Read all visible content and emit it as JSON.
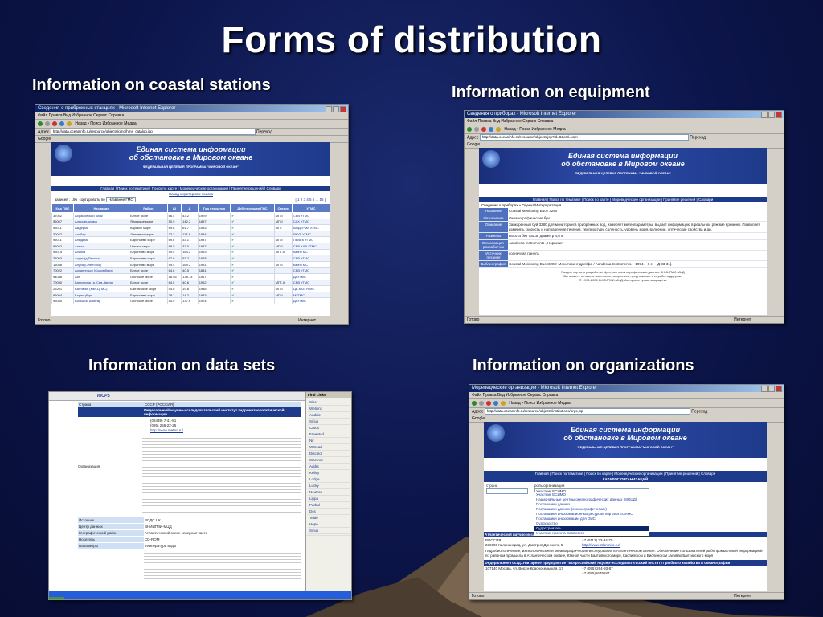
{
  "slide": {
    "title": "Forms of distribution",
    "captions": {
      "coastal": "Information on coastal stations",
      "equipment": "Information on equipment",
      "datasets": "Information on data sets",
      "organizations": "Information on organizations"
    }
  },
  "browser": {
    "status_done": "Готово",
    "status_zone": "Интернет",
    "menu": "Файл  Правка  Вид  Избранное  Сервис  Справка",
    "toolbar": "Назад  •  Поиск  Избранное  Медиа",
    "address_label": "Адрес",
    "go_label": "Переход",
    "google_label": "Google",
    "banner_line1": "Единая система информации",
    "banner_line2": "об обстановке в Мировом океане",
    "banner_sub": "ФЕДЕРАЛЬНАЯ ЦЕЛЕВАЯ ПРОГРАММА \"МИРОВОЙ ОКЕАН\"",
    "nav": "Главная | Поиск по тематике | Поиск по карте | Мореведческие организации | Принятие решений | Словари"
  },
  "coastal": {
    "title": "Сведения о прибрежных станциях - Microsoft Internet Explorer",
    "address": "http://data.oceaninfo.ru/resource/objects/gmo/hms_catalog.jsp",
    "back_link": "Назад к критериям поиска",
    "records": "записей : 196",
    "sort_label": "сортировать по",
    "sort_value": "Название ГМС",
    "pages": "[ 1 2 3 4 5 6 ... 15 ]",
    "columns": [
      "Код ГМС",
      "Название",
      "Район",
      "Ш",
      "Д",
      "Год открытия",
      "Действующая ГМС",
      "Статус",
      "УГМС"
    ],
    "rows": [
      [
        "37062",
        "Абрамовский маяк",
        "Белое море",
        "66.4",
        "43.2",
        "1929",
        "✔",
        "МГ-II",
        "СЕВ УГМС"
      ],
      [
        "96007",
        "Александровск",
        "Японское море",
        "50.9",
        "142.2",
        "1897",
        "✔",
        "МГ-II",
        "САХ УГМС"
      ],
      [
        "95011",
        "Амдерма",
        "Карское море",
        "69.8",
        "61.7",
        "1933",
        "✔",
        "МГ-I",
        "АМДЕРМА УГМС"
      ],
      [
        "30027",
        "Анабар",
        "Лаптевых море",
        "73.2",
        "113.8",
        "1934",
        "✔",
        "",
        "ЯКУТ УГМС"
      ],
      [
        "95011",
        "Аныдьма",
        "Баренцево море",
        "69.6",
        "33.1",
        "1937",
        "✔",
        "МГ-II",
        "ПЕВЕК УГМС"
      ],
      [
        "95062",
        "Анюка",
        "Чукотск море",
        "68.5",
        "37.0",
        "1937",
        "✔",
        "МГ-II",
        "СЕВ-КАВ УГМС"
      ],
      [
        "95015",
        "Анапка",
        "Берингово море",
        "59.5",
        "164.2",
        "1963",
        "✔",
        "МГТ-II",
        "КамУГМС"
      ],
      [
        "37003",
        "Андег (д.Печора)",
        "Баренцево море",
        "67.9",
        "53.2",
        "1978",
        "✔",
        "",
        "СЕВ УГМС"
      ],
      [
        "15036",
        "Апуха (Олюторка)",
        "Берингово море",
        "59.4",
        "169.2",
        "1951",
        "✔",
        "МГ-II",
        "КамУГМС"
      ],
      [
        "70022",
        "Архангельск (Соломбала)",
        "Белое море",
        "64.6",
        "40.5",
        "1881",
        "✔",
        "",
        "СЕВ УГМС"
      ],
      [
        "94046",
        "Аян",
        "Охотское море",
        "56.46",
        "138.13",
        "1917",
        "✔",
        "",
        "ДВУГМС"
      ],
      [
        "70030",
        "Баталрица (д. Сев.Двина)",
        "Белое море",
        "64.5",
        "40.6",
        "1962",
        "✔",
        "МГТ-II",
        "СЕВ УГМС"
      ],
      [
        "26201",
        "Балтийск (Кал-ЦГМС)",
        "Балтийское море",
        "54.6",
        "19.8",
        "1946",
        "✔",
        "МГ-II",
        "ЦБ-КАЛ УГМС"
      ],
      [
        "95004",
        "Баренцбург",
        "Баренцево море",
        "78.1",
        "14.2",
        "1933",
        "✔",
        "МГ-II",
        "МУГМС"
      ],
      [
        "96030",
        "Большой Шантар",
        "Охотское море",
        "54.9",
        "137.6",
        "1924",
        "✔",
        "",
        "ДВУГМС"
      ]
    ]
  },
  "equipment": {
    "title": "Сведения о приборах - Microsoft Internet Explorer",
    "address": "http://data.oceaninfo.ru/resource/objects.jsp?id=8&ord=kam",
    "breadcrumb": "Сведения о приборах » Оценка/Интерпретация",
    "fields": [
      {
        "label": "Название",
        "value": "Coastal Monitoring Buoy 3280"
      },
      {
        "label": "Назначение",
        "value": "Океанографические буи"
      },
      {
        "label": "Описание",
        "value": "Заякоренный буй 3280 для мониторинга прибрежных вод, измеряет метеопараметры, выдает информацию в реальном режиме времени. Позволяет измерять скорость и направление течения, температуру, соленость, уровень моря, волнение, оптические свойства и др."
      },
      {
        "label": "Размеры",
        "value": "высота без троса, диаметр 4,6 м"
      },
      {
        "label": "Организация-разработчик",
        "value": "Aanderaa Instruments , Норвегия"
      },
      {
        "label": "Источник питания",
        "value": "солнечная панель"
      },
      {
        "label": "Библиография",
        "value": "Coastal Monitoring Buoy3280: Мониторинг дрейфа / Aanderaa Instruments. - 1994. - 8 с. - [Д 33-31]."
      }
    ],
    "footer1": "Раздел портала разработан Центром океанографических данных ВНИИГМИ-МЦД",
    "footer2": "Вы можете оставить замечание, вопрос или предложение в службе поддержки",
    "footer3": "© 1999-2005 ВНИИГМИ-МЦД. Авторские права защищены"
  },
  "datasets": {
    "country_label": "Страна",
    "country_value": "СССР (РОССИЯ)",
    "org_label": "Организация",
    "org_value": "Федеральный научно-исследовательский институт гидрометеорологической информации",
    "phone": "(08439) 7-41-81",
    "fax": "(095) 255-22-25",
    "web": "http://www.meteo.ru/",
    "source_label": "Источник",
    "source_value": "ВОДС ЦК",
    "center_label": "Центр данных",
    "center_value": "ВНИИГМИ-МЦД",
    "region_label": "Географический район",
    "region_value": "Атлантический океан северная часть",
    "carrier_label": "Носитель",
    "carrier_value": "CD-ROM",
    "params_label": "Параметры",
    "params_value": "Температура воды",
    "sidebar": [
      "Sibel",
      "Weblink",
      "Andale",
      "Sirius",
      "Cards",
      "FreeMad",
      "Nif",
      "W3read",
      "Discolor",
      "Warsnet",
      "Addrs",
      "Kelley",
      "Lodge",
      "Lucky",
      "Neutron",
      "Lippa",
      "Parbul",
      "Dcs",
      "Telde",
      "Hope",
      "Sirius"
    ],
    "sidebar_title": "Find Links"
  },
  "organizations": {
    "title": "Мореведческие организации - Microsoft Internet Explorer",
    "address": "http://data.oceaninfo.ru/resource/objects/institutions/orgs.jsp",
    "section": "КАТАЛОГ ОРГАНИЗАЦИЙ",
    "filter_country": "страна",
    "filter_role": "роль организации",
    "filter_value": "Участник ЕСИМО",
    "dropdown": [
      "Участник ЕСИМО",
      "Национальные центры океанографических данных (МОЦД)",
      "Поставщики данных",
      "Поставщики данных (океанографических)",
      "Поставщики информационных ресурсов портала ЕСИМО",
      "Поставщики информации для ОИС",
      "Судоходство",
      "Судостроитель",
      "Участник проекта SeaSearch"
    ],
    "org1": "Атлантический научно-исследовательский институт рыбного хозяйства и океанографии",
    "org1_addr": "236000 Калининград, ул. Дмитрия Донского, 5",
    "org1_country": "РОССИЯ",
    "org1_phone": "+7 (0112) 33-34-70",
    "org1_web": "http://www.atlantniro.ru/",
    "org1_desc": "Гидробиологические, ихтиологические и океанографические исследования в Атлантическом океане. Обеспечение пользователей рыбопромысловой информацией по районам промысла в Атлантическом океане, Южной части Балтийского моря, Каспийском и Вислинском заливах Балтийского моря",
    "org2": "Федеральное ГосУд. Унитарное предприятие \"Всероссийский научно-исследовательский институт рыбного хозяйства и океанографии\"",
    "org2_addr": "107140 Москва, ул. Верхн-Красносельская, 17",
    "org2_phone": "+7 (095) 264-93-87",
    "org2_fax": "+7 (095)2649187"
  },
  "colors": {
    "slide_bg": "#0c154a",
    "caption": "#ffffff",
    "banner": "#1e3a8a",
    "table_header": "#5b7bc7"
  }
}
